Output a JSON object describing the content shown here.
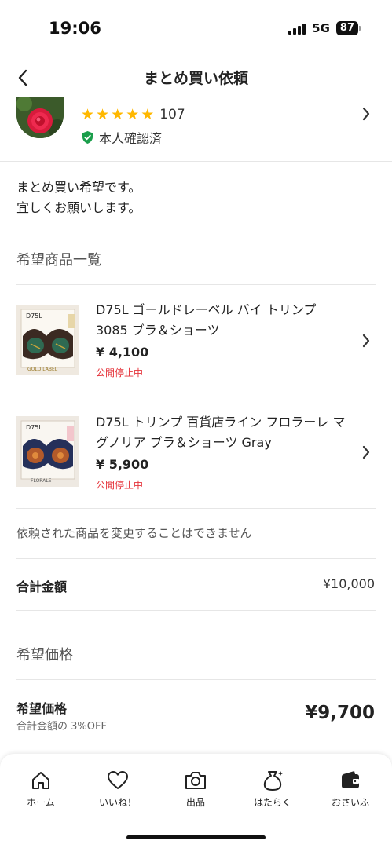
{
  "status_bar": {
    "time": "19:06",
    "network": "5G",
    "battery": "87"
  },
  "header": {
    "title": "まとめ買い依頼"
  },
  "seller": {
    "rating_count": "107",
    "verified_label": "本人確認済"
  },
  "message": {
    "line1": "まとめ買い希望です。",
    "line2": "宜しくお願いします。"
  },
  "items_section": {
    "title": "希望商品一覧"
  },
  "items": [
    {
      "name": "D75L ゴールドレーベル バイ トリンプ 3085 ブラ＆ショーツ",
      "price": "¥ 4,100",
      "status": "公開停止中",
      "thumb_label": "D75L",
      "thumb_brand": "GOLD LABEL"
    },
    {
      "name": "D75L トリンプ 百貨店ライン フロラーレ マグノリア ブラ＆ショーツ Gray",
      "price": "¥ 5,900",
      "status": "公開停止中",
      "thumb_label": "D75L",
      "thumb_brand": "FLORALE"
    }
  ],
  "note": "依頼された商品を変更することはできません",
  "total": {
    "label": "合計金額",
    "value": "¥10,000"
  },
  "request_section": {
    "title": "希望価格"
  },
  "request_price": {
    "label": "希望価格",
    "sub": "合計金額の 3%OFF",
    "value": "¥9,700"
  },
  "tabbar": [
    {
      "label": "ホーム",
      "icon": "home-icon"
    },
    {
      "label": "いいね！",
      "icon": "heart-icon"
    },
    {
      "label": "出品",
      "icon": "camera-icon"
    },
    {
      "label": "はたらく",
      "icon": "money-bag-icon"
    },
    {
      "label": "おさいふ",
      "icon": "wallet-icon"
    }
  ],
  "colors": {
    "star": "#ffb800",
    "verified": "#1a9e4b",
    "status_red": "#e5333a",
    "text": "#222222"
  }
}
